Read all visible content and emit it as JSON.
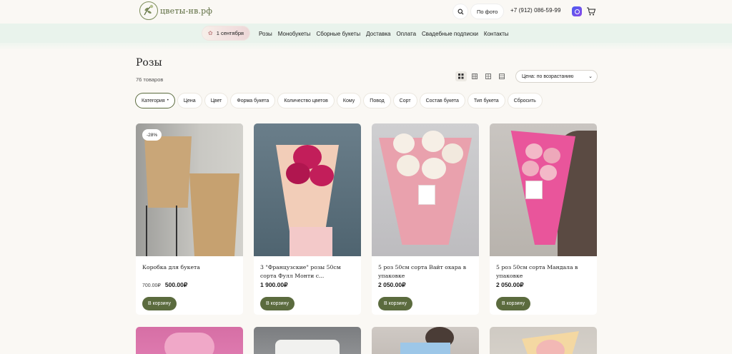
{
  "header": {
    "logo_text": "цветы-нв.рф",
    "photo_search_label": "По фото",
    "phone": "+7 (912) 086-59-99",
    "icons": {
      "search": "search-icon",
      "max": "max-messenger-icon",
      "cart": "cart-icon",
      "logo": "flower-logo-icon"
    }
  },
  "nav": {
    "promo_label": "1 сентября",
    "links": [
      "Розы",
      "Монобукеты",
      "Сборные букеты",
      "Доставка",
      "Оплата",
      "Свадебные подписки",
      "Контакты"
    ]
  },
  "page": {
    "title": "Розы",
    "count": "76 товаров",
    "sort_value": "Цена: по возрастанию"
  },
  "filters": [
    "Категория",
    "Цена",
    "Цвет",
    "Форма букета",
    "Количество цветов",
    "Кому",
    "Повод",
    "Сорт",
    "Состав букета",
    "Тип букета",
    "Сбросить"
  ],
  "filter_active_marker": "•",
  "products": [
    {
      "name": "Коробка для букета",
      "old_price": "700.00₽",
      "price": "500.00₽",
      "badge": "-28%",
      "cart_label": "В корзину"
    },
    {
      "name": "3 \"Французские\" розы 50см сорта Фулл Монти с...",
      "old_price": "",
      "price": "1 900.00₽",
      "badge": "",
      "cart_label": "В корзину"
    },
    {
      "name": "5 роз 50см сорта Вайт охара в упаковке",
      "old_price": "",
      "price": "2 050.00₽",
      "badge": "",
      "cart_label": "В корзину"
    },
    {
      "name": "5 роз 50см сорта Мандала в упаковке",
      "old_price": "",
      "price": "2 050.00₽",
      "badge": "",
      "cart_label": "В корзину"
    }
  ],
  "colors": {
    "accent": "#5b6b3e",
    "nav_bg": "#e9f3ec",
    "page_bg": "#faf8f4"
  }
}
